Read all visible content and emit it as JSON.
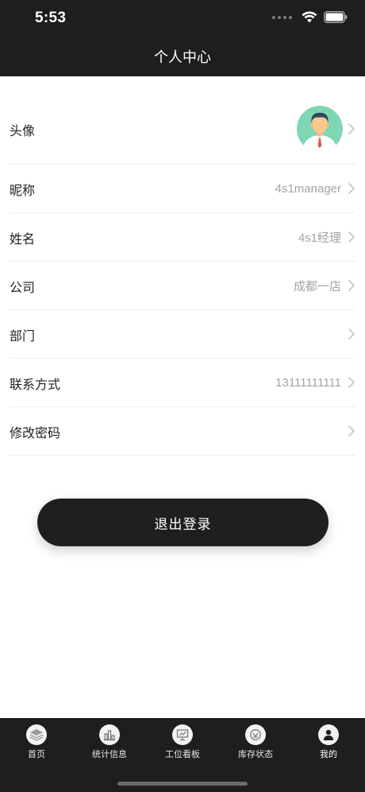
{
  "status_bar": {
    "time": "5:53"
  },
  "header": {
    "title": "个人中心"
  },
  "profile": {
    "rows": [
      {
        "label": "头像",
        "value": "",
        "icon": "avatar-icon"
      },
      {
        "label": "昵称",
        "value": "4s1manager"
      },
      {
        "label": "姓名",
        "value": "4s1经理"
      },
      {
        "label": "公司",
        "value": "成都一店"
      },
      {
        "label": "部门",
        "value": ""
      },
      {
        "label": "联系方式",
        "value": "13111111111"
      },
      {
        "label": "修改密码",
        "value": ""
      }
    ]
  },
  "logout": {
    "label": "退出登录"
  },
  "tabbar": {
    "items": [
      {
        "label": "首页",
        "icon": "layers-icon"
      },
      {
        "label": "统计信息",
        "icon": "bar-chart-icon"
      },
      {
        "label": "工位看板",
        "icon": "board-icon"
      },
      {
        "label": "库存状态",
        "icon": "stock-icon"
      },
      {
        "label": "我的",
        "icon": "user-icon",
        "active": true
      }
    ]
  },
  "colors": {
    "dark": "#1e1e1e",
    "value_gray": "#a3a3a3",
    "avatar_bg": "#7fd6b3"
  }
}
